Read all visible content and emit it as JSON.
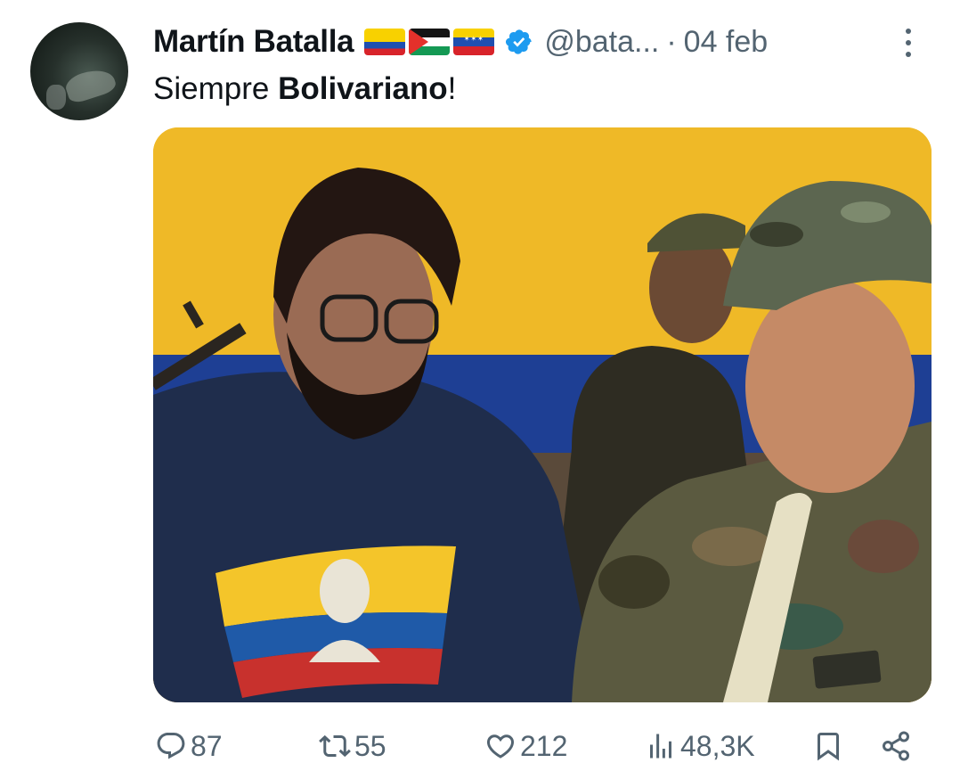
{
  "tweet": {
    "author_name": "Martín Batalla",
    "flags": [
      "colombia-flag",
      "palestine-flag",
      "venezuela-flag"
    ],
    "verified": true,
    "handle": "@bata...",
    "separator": "·",
    "date": "04 feb",
    "text_part1": "Siempre ",
    "text_bold": "Bolivariano",
    "text_part2": "!"
  },
  "actions": {
    "replies": "87",
    "retweets": "55",
    "likes": "212",
    "views": "48,3K"
  },
  "colors": {
    "text": "#0f1419",
    "secondary": "#536471",
    "verified_blue": "#1d9bf0"
  },
  "icons": [
    "more-icon",
    "verified-icon",
    "reply-icon",
    "retweet-icon",
    "like-icon",
    "views-icon",
    "bookmark-icon",
    "share-icon"
  ]
}
